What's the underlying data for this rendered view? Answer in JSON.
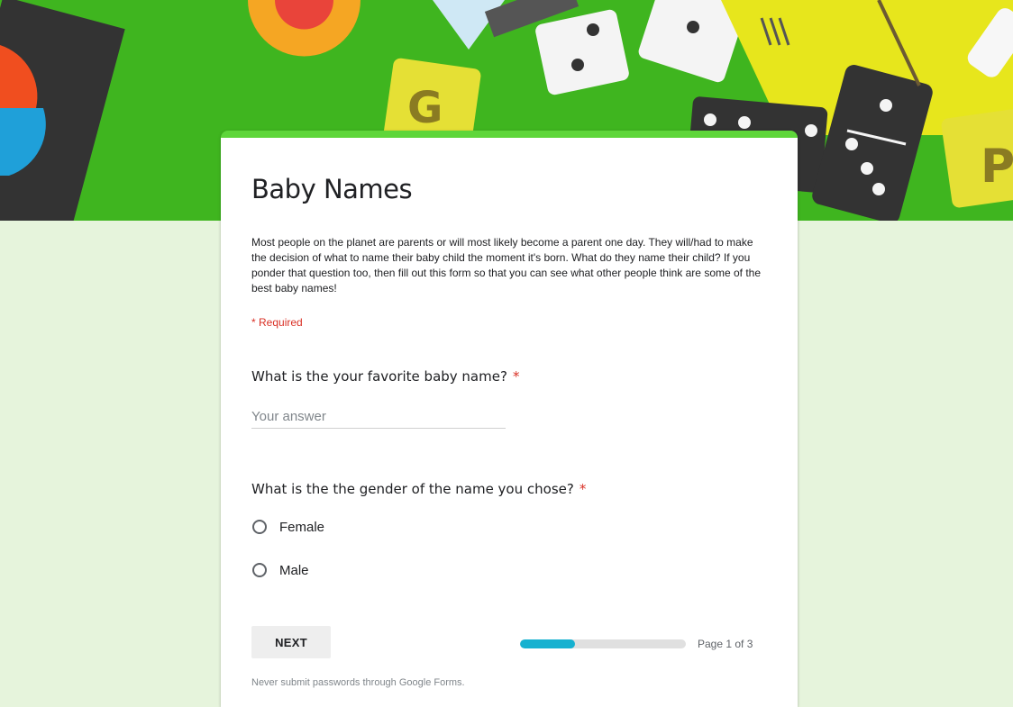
{
  "form": {
    "title": "Baby Names",
    "description": "Most people on the planet are parents or will most likely become a parent one day. They will/had to make the decision of what to name their baby child the moment it's born. What do they name their child? If you ponder that question too, then fill out this form so that you can see what other people think are some of the best baby names!",
    "required_note": "* Required",
    "accent_color": "#5ed63a",
    "banner_color": "#3fb51f"
  },
  "questions": [
    {
      "label": "What is the your favorite baby name?",
      "required_mark": "*",
      "placeholder": "Your answer"
    },
    {
      "label": "What is the the gender of the name you chose?",
      "required_mark": "*",
      "options": [
        "Female",
        "Male"
      ]
    }
  ],
  "navigation": {
    "next_label": "NEXT",
    "page_indicator": "Page 1 of 3",
    "progress_fraction": 0.333,
    "progress_color": "#16b1d0"
  },
  "footer": {
    "note": "Never submit passwords through Google Forms."
  },
  "banner_letters": [
    "G",
    "P"
  ]
}
